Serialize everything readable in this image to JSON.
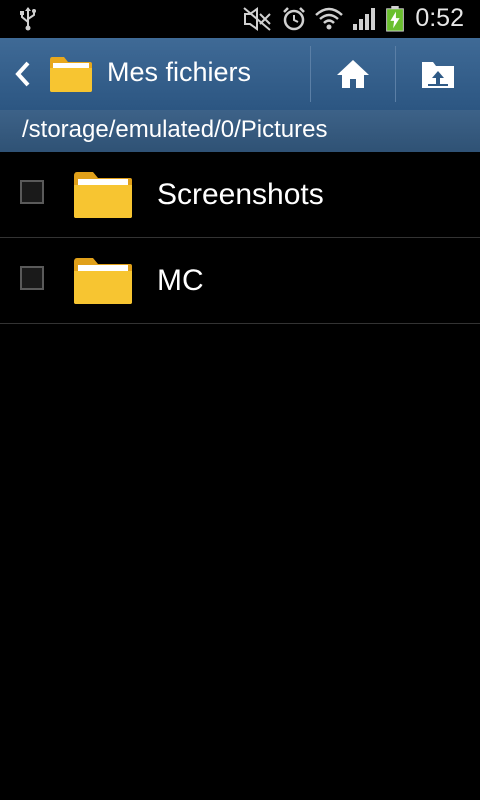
{
  "status_bar": {
    "time": "0:52",
    "icons": [
      "usb-icon",
      "mute-icon",
      "alarm-icon",
      "wifi-icon",
      "signal-icon",
      "battery-charging-icon"
    ]
  },
  "action_bar": {
    "title": "Mes fichiers",
    "back_icon": "chevron-left-icon",
    "app_icon": "folder-icon",
    "home_icon": "home-icon",
    "upload_icon": "folder-up-icon"
  },
  "path": "/storage/emulated/0/Pictures",
  "items": [
    {
      "name": "Screenshots",
      "type": "folder",
      "checked": false
    },
    {
      "name": "MC",
      "type": "folder",
      "checked": false
    }
  ],
  "colors": {
    "action_bar": "#35608c",
    "path_bar": "#365a7e",
    "folder": "#f5c02a",
    "background": "#000000"
  }
}
